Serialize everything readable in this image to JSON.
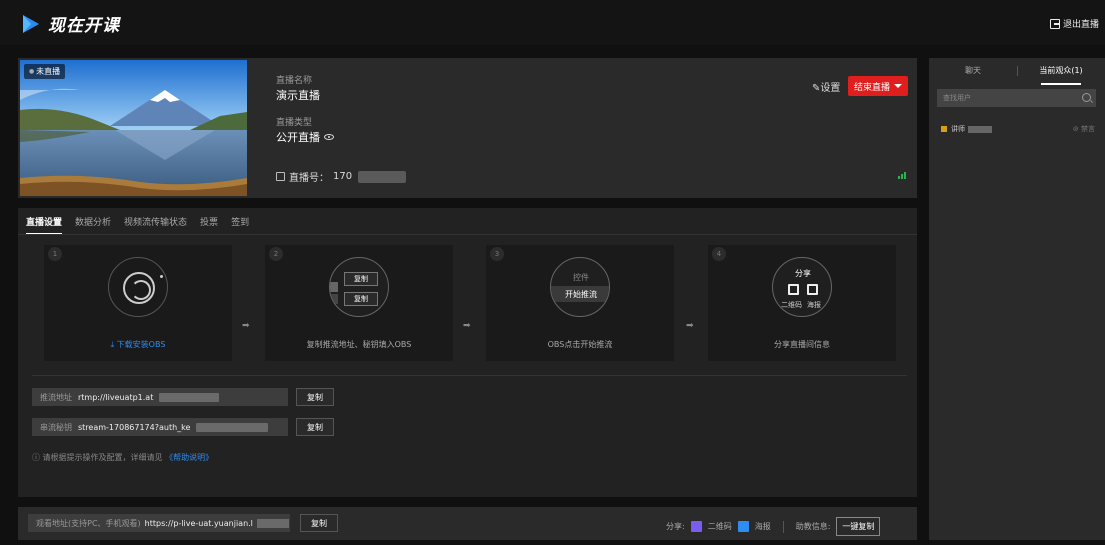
{
  "header": {
    "brand": "现在开课",
    "exit_label": "退出直播"
  },
  "live_info": {
    "status_badge": "未直播",
    "name_label": "直播名称",
    "name_value": "演示直播",
    "type_label": "直播类型",
    "type_value": "公开直播",
    "room_label": "直播号：",
    "room_value": "170",
    "settings_label": "设置",
    "end_button_label": "结束直播"
  },
  "tabs": [
    "直播设置",
    "数据分析",
    "视频流传输状态",
    "投票",
    "签到"
  ],
  "steps": [
    {
      "num": "1",
      "caption": "下载安装OBS"
    },
    {
      "num": "2",
      "caption": "复制推流地址、秘钥填入OBS",
      "btn1": "复制",
      "btn2": "复制"
    },
    {
      "num": "3",
      "caption": "OBS点击开始推流",
      "ctrl_top": "控件",
      "ctrl_mid": "开始推流"
    },
    {
      "num": "4",
      "caption": "分享直播间信息",
      "share_title": "分享",
      "qr_label": "二维码",
      "poster_label": "海报"
    }
  ],
  "push": {
    "url_label": "推流地址",
    "url_value": "rtmp://liveuatp1.at",
    "key_label": "串流秘钥",
    "key_value": "stream-170867174?auth_ke",
    "copy_label": "复制",
    "hint_text": "请根据提示操作及配置，详细请见",
    "help_link": "《帮助说明》"
  },
  "watch": {
    "url_label": "观看地址(支持PC、手机观看)",
    "url_value": "https://p-live-uat.yuanjian.l",
    "copy_label": "复制",
    "share_label": "分享:",
    "qr_label": "二维码",
    "poster_label": "海报",
    "assist_label": "助教信息:",
    "onekey_label": "一键复制"
  },
  "sidebar": {
    "tab_chat": "聊天",
    "tab_audience": "当前观众(1)",
    "search_placeholder": "查找用户",
    "user_prefix": "讲师",
    "mute_label": "禁言"
  }
}
